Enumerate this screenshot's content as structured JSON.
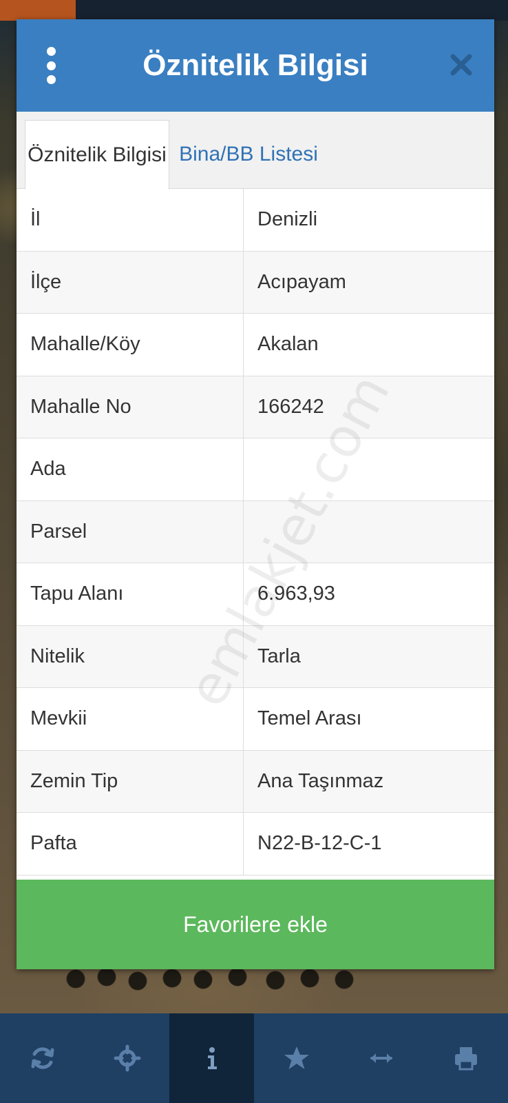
{
  "modal": {
    "title": "Öznitelik Bilgisi",
    "tabs": [
      {
        "label": "Öznitelik Bilgisi",
        "active": true
      },
      {
        "label": "Bina/BB Listesi",
        "active": false
      }
    ],
    "rows": [
      {
        "key": "İl",
        "value": "Denizli"
      },
      {
        "key": "İlçe",
        "value": "Acıpayam"
      },
      {
        "key": "Mahalle/Köy",
        "value": "Akalan"
      },
      {
        "key": "Mahalle No",
        "value": "166242"
      },
      {
        "key": "Ada",
        "value": ""
      },
      {
        "key": "Parsel",
        "value": ""
      },
      {
        "key": "Tapu Alanı",
        "value": "6.963,93"
      },
      {
        "key": "Nitelik",
        "value": "Tarla"
      },
      {
        "key": "Mevkii",
        "value": "Temel Arası"
      },
      {
        "key": "Zemin Tip",
        "value": "Ana Taşınmaz"
      },
      {
        "key": "Pafta",
        "value": "N22-B-12-C-1"
      }
    ],
    "favorite_button": "Favorilere ekle"
  },
  "watermark": "emlakjet.com",
  "bottom_nav": [
    {
      "icon": "refresh-icon",
      "active": false
    },
    {
      "icon": "crosshair-icon",
      "active": false
    },
    {
      "icon": "info-icon",
      "active": true
    },
    {
      "icon": "star-icon",
      "active": false
    },
    {
      "icon": "measure-icon",
      "active": false
    },
    {
      "icon": "print-icon",
      "active": false
    }
  ],
  "colors": {
    "header": "#3a7fc1",
    "tab_link": "#2f72b5",
    "favorite": "#5cb85c",
    "bottom_bar": "#1f3f63",
    "bottom_bar_active": "#10243a"
  }
}
